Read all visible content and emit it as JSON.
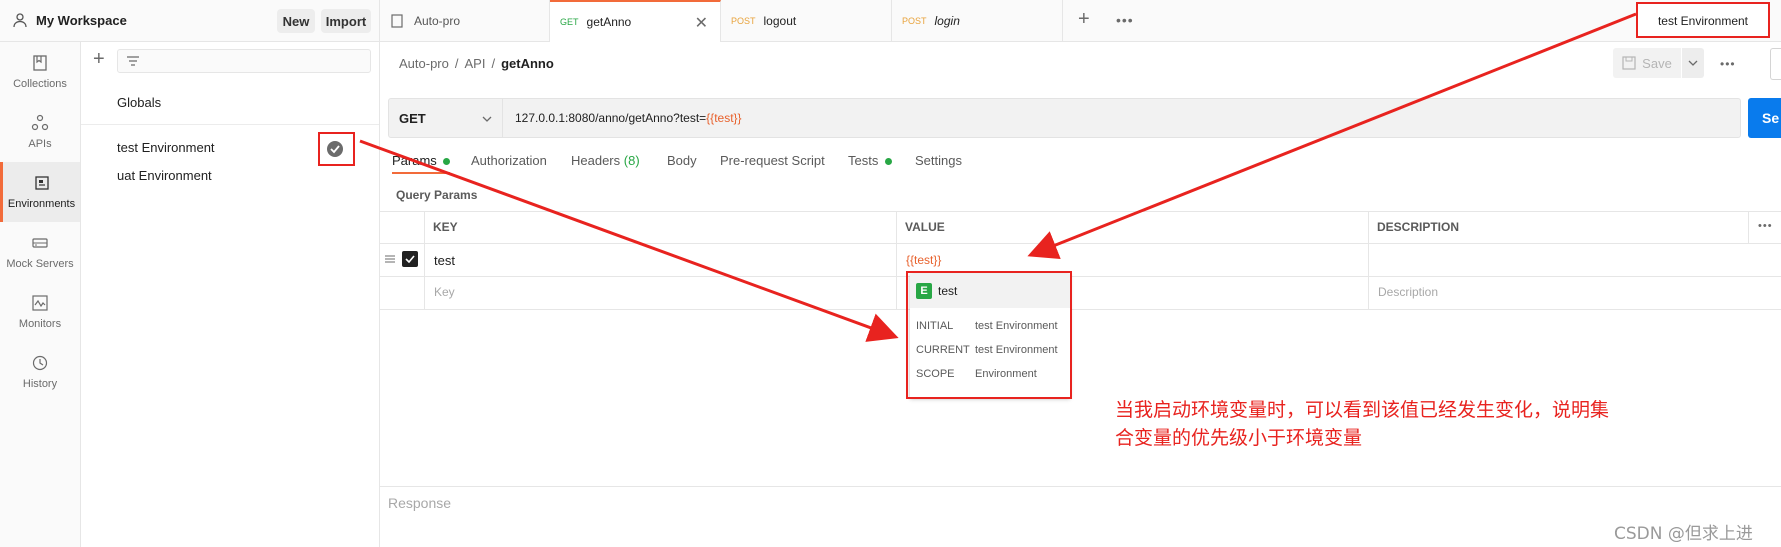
{
  "workspace": {
    "title": "My Workspace",
    "new_label": "New",
    "import_label": "Import"
  },
  "rail": {
    "items": [
      {
        "label": "Collections"
      },
      {
        "label": "APIs"
      },
      {
        "label": "Environments"
      },
      {
        "label": "Mock Servers"
      },
      {
        "label": "Monitors"
      },
      {
        "label": "History"
      }
    ]
  },
  "envlist": {
    "globals": "Globals",
    "items": [
      "test Environment",
      "uat Environment"
    ]
  },
  "tabs": [
    {
      "method": "",
      "name": "Auto-pro"
    },
    {
      "method": "GET",
      "name": "getAnno"
    },
    {
      "method": "POST",
      "name": "logout"
    },
    {
      "method": "POST",
      "name": "login"
    }
  ],
  "env_selector": "test Environment",
  "breadcrumb": {
    "a": "Auto-pro",
    "sep": "/",
    "b": "API",
    "c": "getAnno"
  },
  "toolbar": {
    "save_label": "Save"
  },
  "request": {
    "method": "GET",
    "url_prefix": "127.0.0.1:8080/anno/getAnno?test=",
    "url_var": "{{test}}",
    "send_label": "Se"
  },
  "req_tabs": {
    "params": "Params",
    "authorization": "Authorization",
    "headers": "Headers",
    "headers_count": "(8)",
    "body": "Body",
    "prerequest": "Pre-request Script",
    "tests": "Tests",
    "settings": "Settings"
  },
  "query_params": {
    "title": "Query Params",
    "columns": [
      "KEY",
      "VALUE",
      "DESCRIPTION"
    ],
    "row_key": "test",
    "row_value": "{{test}}",
    "key_placeholder": "Key",
    "desc_placeholder": "Description"
  },
  "tooltip": {
    "badge": "E",
    "name": "test",
    "rows": [
      {
        "label": "INITIAL",
        "value": "test Environment"
      },
      {
        "label": "CURRENT",
        "value": "test Environment"
      },
      {
        "label": "SCOPE",
        "value": "Environment"
      }
    ]
  },
  "annotation": {
    "line1": "当我启动环境变量时，可以看到该值已经发生变化，说明集",
    "line2": "合变量的优先级小于环境变量"
  },
  "response": {
    "label": "Response"
  },
  "watermark": "CSDN @但求上进",
  "colors": {
    "accent": "#f26b3a",
    "send": "#097bed",
    "annotation": "#e8231f",
    "var": "#e8612c",
    "green": "#28a745"
  }
}
